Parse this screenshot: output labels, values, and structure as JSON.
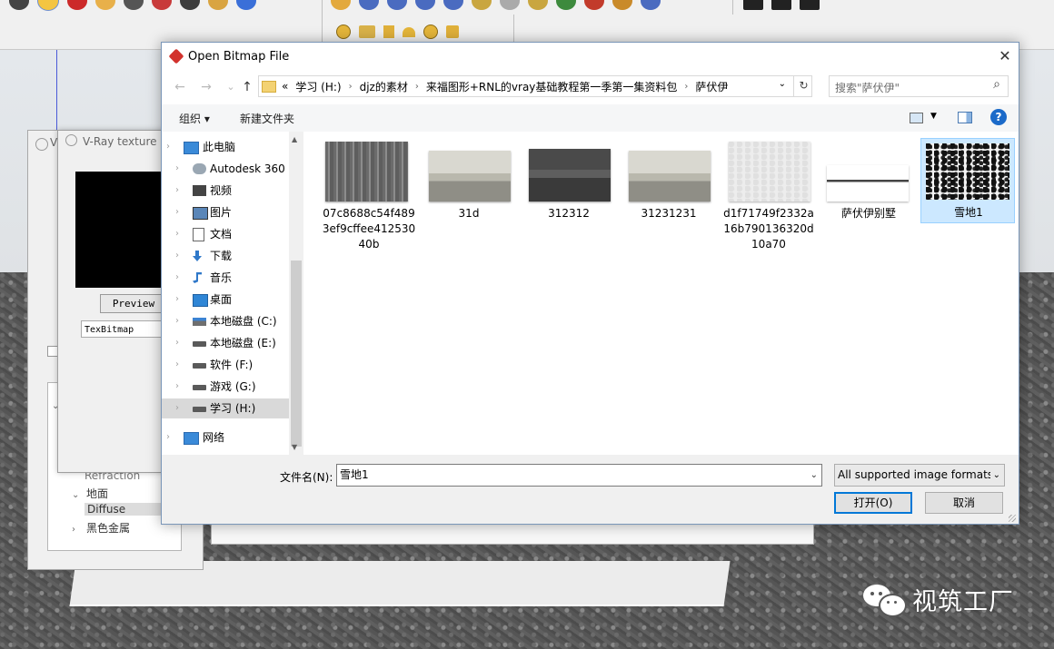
{
  "dialog": {
    "title": "Open Bitmap File",
    "close_glyph": "✕",
    "nav": {
      "back_glyph": "←",
      "forward_glyph": "→",
      "up_glyph": "↑"
    },
    "address": {
      "lead": "«",
      "crumbs": [
        "学习 (H:)",
        "djz的素材",
        "来福图形+RNL的vray基础教程第一季第一集资料包",
        "萨伏伊"
      ],
      "separator": "›"
    },
    "search": {
      "placeholder": "搜索\"萨伏伊\""
    },
    "commands": {
      "organize": "组织 ▾",
      "new_folder": "新建文件夹",
      "help": "?"
    },
    "nav_pane": [
      {
        "label": "此电脑",
        "icon": "computer-icon",
        "top": true
      },
      {
        "label": "Autodesk 360",
        "icon": "cloud-icon"
      },
      {
        "label": "视频",
        "icon": "video-icon"
      },
      {
        "label": "图片",
        "icon": "pictures-icon"
      },
      {
        "label": "文档",
        "icon": "documents-icon"
      },
      {
        "label": "下载",
        "icon": "download-icon"
      },
      {
        "label": "音乐",
        "icon": "music-icon"
      },
      {
        "label": "桌面",
        "icon": "desktop-icon"
      },
      {
        "label": "本地磁盘 (C:)",
        "icon": "drive-c-icon"
      },
      {
        "label": "本地磁盘 (E:)",
        "icon": "drive-icon"
      },
      {
        "label": "软件 (F:)",
        "icon": "drive-icon"
      },
      {
        "label": "游戏 (G:)",
        "icon": "drive-icon"
      },
      {
        "label": "学习 (H:)",
        "icon": "drive-icon",
        "selected": true
      },
      {
        "label": "网络",
        "icon": "network-icon",
        "top": true
      }
    ],
    "files": [
      {
        "name": "07c8688c54f4893ef9cffee41253040b",
        "thumb": "concrete-wall-thumbnail"
      },
      {
        "name": "31d",
        "thumb": "villa-render-thumbnail"
      },
      {
        "name": "312312",
        "thumb": "dark-render-thumbnail"
      },
      {
        "name": "31231231",
        "thumb": "villa-render-thumbnail"
      },
      {
        "name": "d1f71749f2332a16b790136320d10a70",
        "thumb": "white-texture-thumbnail"
      },
      {
        "name": "萨伏伊别墅",
        "thumb": "villa-elevation-thumbnail"
      },
      {
        "name": "雪地1",
        "thumb": "snow-texture-thumbnail",
        "selected": true
      }
    ],
    "filename_label": "文件名(N):",
    "filename_value": "雪地1",
    "file_type": "All supported image formats",
    "open_button": "打开(O)",
    "cancel_button": "取消"
  },
  "vray_texture_editor": {
    "title": "V-Ray texture e",
    "preview_label": "Preview",
    "type_value": "TexBitmap"
  },
  "material_editor": {
    "title_initial": "V",
    "items": [
      {
        "label": "N",
        "indent": 0,
        "arrow": ""
      },
      {
        "label": "Refraction",
        "indent": 1,
        "arrow": ""
      },
      {
        "label": "地面",
        "indent": 0,
        "arrow": "⌄"
      },
      {
        "label": "Diffuse",
        "indent": 1,
        "arrow": "",
        "selected": true
      },
      {
        "label": "黑色金属",
        "indent": 0,
        "arrow": "›"
      }
    ]
  },
  "watermark": {
    "text": "视筑工厂"
  },
  "colors": {
    "accent": "#0078d7",
    "selection": "#cce8ff",
    "help": "#1b6ac9"
  }
}
